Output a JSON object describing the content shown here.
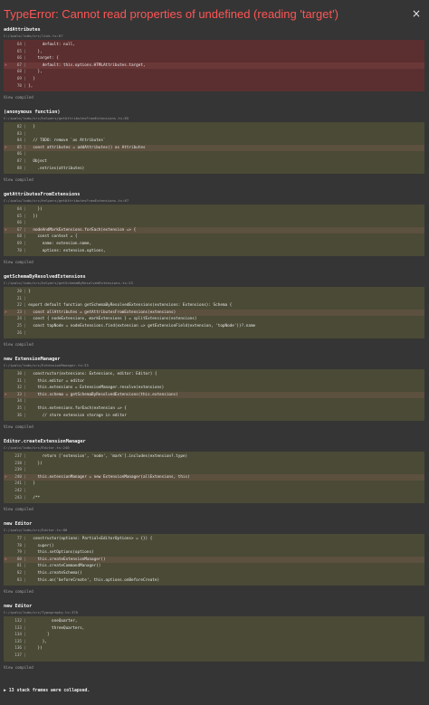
{
  "error": {
    "title": "TypeError: Cannot read properties of undefined (reading 'target')",
    "close_glyph": "×"
  },
  "frames": [
    {
      "name": "addAttributes",
      "path": "C:/ipalo/lodo/src/link.ts:67",
      "style": "red",
      "lines": [
        {
          "n": "64",
          "t": "      default: null,",
          "hl": false
        },
        {
          "n": "65",
          "t": "    },",
          "hl": false
        },
        {
          "n": "66",
          "t": "    target: {",
          "hl": false
        },
        {
          "n": "67",
          "t": "      default: this.options.HTMLAttributes.target,",
          "hl": true
        },
        {
          "n": "68",
          "t": "    },",
          "hl": false
        },
        {
          "n": "69",
          "t": "  }",
          "hl": false
        },
        {
          "n": "70",
          "t": "},",
          "hl": false
        }
      ],
      "view": "View compiled"
    },
    {
      "name": "(anonymous function)",
      "path": "C:/ipalo/lodo/src/helpers/getAttributesFromExtensions.ts:85",
      "style": "olive",
      "lines": [
        {
          "n": "82",
          "t": "  }",
          "hl": false
        },
        {
          "n": "83",
          "t": "",
          "hl": false
        },
        {
          "n": "84",
          "t": "  // TODO: remove `as Attributes`",
          "hl": false
        },
        {
          "n": "85",
          "t": "  const attributes = addAttributes() as Attributes",
          "hl": true
        },
        {
          "n": "86",
          "t": "",
          "hl": false
        },
        {
          "n": "87",
          "t": "  Object",
          "hl": false
        },
        {
          "n": "88",
          "t": "    .entries(attributes)",
          "hl": false
        }
      ],
      "view": "View compiled"
    },
    {
      "name": "getAttributesFromExtensions",
      "path": "C:/ipalo/lodo/src/helpers/getAttributesFromExtensions.ts:67",
      "style": "olive",
      "lines": [
        {
          "n": "64",
          "t": "    })",
          "hl": false
        },
        {
          "n": "65",
          "t": "  })",
          "hl": false
        },
        {
          "n": "66",
          "t": "",
          "hl": false
        },
        {
          "n": "67",
          "t": "  nodeAndMarkExtensions.forEach(extension => {",
          "hl": true
        },
        {
          "n": "68",
          "t": "    const context = {",
          "hl": false
        },
        {
          "n": "69",
          "t": "      name: extension.name,",
          "hl": false
        },
        {
          "n": "70",
          "t": "      options: extension.options,",
          "hl": false
        }
      ],
      "view": "View compiled"
    },
    {
      "name": "getSchemaByResolvedExtensions",
      "path": "C:/ipalo/lodo/src/helpers/getSchemaByResolvedExtensions.ts:23",
      "style": "olive",
      "lines": [
        {
          "n": "20",
          "t": "}",
          "hl": false
        },
        {
          "n": "21",
          "t": "",
          "hl": false
        },
        {
          "n": "22",
          "t": "export default function getSchemaByResolvedExtensions(extensions: Extensions): Schema {",
          "hl": false
        },
        {
          "n": "23",
          "t": "  const allAttributes = getAttributesFromExtensions(extensions)",
          "hl": true
        },
        {
          "n": "24",
          "t": "  const { nodeExtensions, markExtensions } = splitExtensions(extensions)",
          "hl": false
        },
        {
          "n": "25",
          "t": "  const topNode = nodeExtensions.find(extension => getExtensionField(extension, 'topNode'))?.name",
          "hl": false
        },
        {
          "n": "26",
          "t": "",
          "hl": false
        }
      ],
      "view": "View compiled"
    },
    {
      "name": "new ExtensionManager",
      "path": "C:/ipalo/lodo/src/ExtensionManager.ts:33",
      "style": "olive",
      "lines": [
        {
          "n": "30",
          "t": "  constructor(extensions: Extensions, editor: Editor) {",
          "hl": false
        },
        {
          "n": "31",
          "t": "    this.editor = editor",
          "hl": false
        },
        {
          "n": "32",
          "t": "    this.extensions = ExtensionManager.resolve(extensions)",
          "hl": false
        },
        {
          "n": "33",
          "t": "    this.schema = getSchemaByResolvedExtensions(this.extensions)",
          "hl": true
        },
        {
          "n": "34",
          "t": "",
          "hl": false
        },
        {
          "n": "35",
          "t": "    this.extensions.forEach(extension => {",
          "hl": false
        },
        {
          "n": "36",
          "t": "      // store extension storage in editor",
          "hl": false
        }
      ],
      "view": "View compiled"
    },
    {
      "name": "Editor.createExtensionManager",
      "path": "C:/ipalo/lodo/src/Editor.ts:240",
      "style": "olive",
      "lines": [
        {
          "n": "237",
          "t": "      return ['extension', 'node', 'mark'].includes(extension?.type)",
          "hl": false
        },
        {
          "n": "238",
          "t": "    })",
          "hl": false
        },
        {
          "n": "239",
          "t": "",
          "hl": false
        },
        {
          "n": "240",
          "t": "    this.extensionManager = new ExtensionManager(allExtensions, this)",
          "hl": true
        },
        {
          "n": "241",
          "t": "  }",
          "hl": false
        },
        {
          "n": "242",
          "t": "",
          "hl": false
        },
        {
          "n": "243",
          "t": "  /**",
          "hl": false
        }
      ],
      "view": "View compiled"
    },
    {
      "name": "new Editor",
      "path": "C:/ipalo/lodo/src/Editor.ts:80",
      "style": "olive",
      "lines": [
        {
          "n": "77",
          "t": "  constructor(options: Partial<EditorOptions> = {}) {",
          "hl": false
        },
        {
          "n": "78",
          "t": "    super()",
          "hl": false
        },
        {
          "n": "79",
          "t": "    this.setOptions(options)",
          "hl": false
        },
        {
          "n": "80",
          "t": "    this.createExtensionManager()",
          "hl": true
        },
        {
          "n": "81",
          "t": "    this.createCommandManager()",
          "hl": false
        },
        {
          "n": "82",
          "t": "    this.createSchema()",
          "hl": false
        },
        {
          "n": "83",
          "t": "    this.on('beforeCreate', this.options.onBeforeCreate)",
          "hl": false
        }
      ],
      "view": "View compiled"
    },
    {
      "name": "new Editor",
      "path": "C:/ipalo/lodo/src/Typography.ts:370",
      "style": "olive",
      "lines": [
        {
          "n": "132",
          "t": "          oneQuarter,",
          "hl": false
        },
        {
          "n": "133",
          "t": "          threeQuarters,",
          "hl": false
        },
        {
          "n": "134",
          "t": "        ]",
          "hl": false
        },
        {
          "n": "135",
          "t": "      },",
          "hl": false
        },
        {
          "n": "136",
          "t": "    })",
          "hl": false
        },
        {
          "n": "137",
          "t": "",
          "hl": false
        }
      ],
      "view": "View compiled"
    }
  ],
  "collapsed_label": "▶ 13 stack frames were collapsed."
}
